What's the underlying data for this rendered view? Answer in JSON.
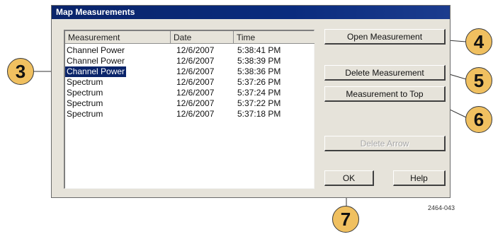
{
  "dialog": {
    "title": "Map Measurements"
  },
  "list": {
    "columns": [
      "Measurement",
      "Date",
      "Time"
    ],
    "rows": [
      {
        "measurement": "Channel Power",
        "date": "12/6/2007",
        "time": "5:38:41 PM",
        "selected": false
      },
      {
        "measurement": "Channel Power",
        "date": "12/6/2007",
        "time": "5:38:39 PM",
        "selected": false
      },
      {
        "measurement": "Channel Power",
        "date": "12/6/2007",
        "time": "5:38:36 PM",
        "selected": true
      },
      {
        "measurement": "Spectrum",
        "date": "12/6/2007",
        "time": "5:37:26 PM",
        "selected": false
      },
      {
        "measurement": "Spectrum",
        "date": "12/6/2007",
        "time": "5:37:24 PM",
        "selected": false
      },
      {
        "measurement": "Spectrum",
        "date": "12/6/2007",
        "time": "5:37:22 PM",
        "selected": false
      },
      {
        "measurement": "Spectrum",
        "date": "12/6/2007",
        "time": "5:37:18 PM",
        "selected": false
      }
    ]
  },
  "buttons": {
    "open_measurement": "Open Measurement",
    "delete_measurement": "Delete Measurement",
    "measurement_to_top": "Measurement to Top",
    "delete_arrow": "Delete Arrow",
    "ok": "OK",
    "help": "Help"
  },
  "callouts": {
    "c3": "3",
    "c4": "4",
    "c5": "5",
    "c6": "6",
    "c7": "7"
  },
  "figure_code": "2464-043",
  "colors": {
    "title_bar": "#0a246a",
    "dialog_face": "#e6e3da",
    "selection": "#0a246a",
    "callout_fill": "#f0c060"
  }
}
